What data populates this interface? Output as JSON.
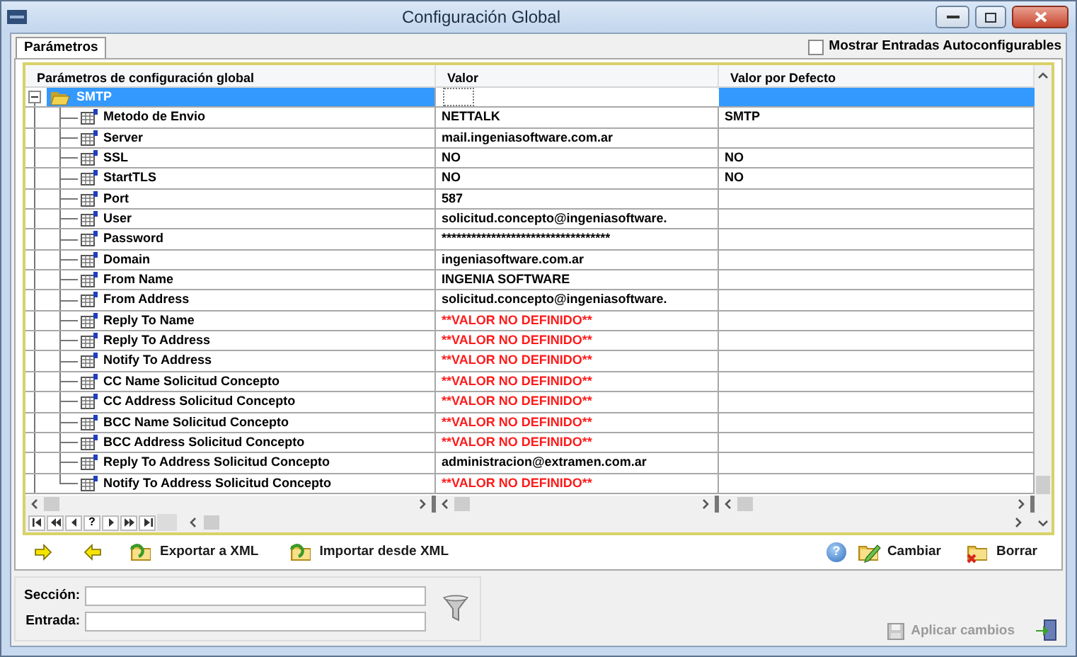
{
  "window": {
    "title": "Configuración Global"
  },
  "tabs": [
    {
      "label": "Parámetros",
      "selected": true
    }
  ],
  "show_auto_checkbox": {
    "label": "Mostrar Entradas Autoconfigurables",
    "checked": false
  },
  "grid": {
    "columns": [
      "Parámetros de configuración global",
      "Valor",
      "Valor por Defecto"
    ],
    "root": {
      "label": "SMTP",
      "expanded": true,
      "selected": true,
      "children": [
        {
          "name": "Metodo de Envio",
          "value": "NETTALK",
          "default": "SMTP",
          "missing": false
        },
        {
          "name": "Server",
          "value": "mail.ingeniasoftware.com.ar",
          "missing": false
        },
        {
          "name": "SSL",
          "value": "NO",
          "default": "NO",
          "missing": false
        },
        {
          "name": "StartTLS",
          "value": "NO",
          "default": "NO",
          "missing": false
        },
        {
          "name": "Port",
          "value": "587",
          "missing": false
        },
        {
          "name": "User",
          "value": "solicitud.concepto@ingeniasoftware.",
          "missing": false
        },
        {
          "name": "Password",
          "value": "**********************************",
          "missing": false
        },
        {
          "name": "Domain",
          "value": "ingeniasoftware.com.ar",
          "missing": false
        },
        {
          "name": "From Name",
          "value": "INGENIA SOFTWARE",
          "missing": false
        },
        {
          "name": "From Address",
          "value": "solicitud.concepto@ingeniasoftware.",
          "missing": false
        },
        {
          "name": "Reply To Name",
          "value": "**VALOR NO DEFINIDO**",
          "missing": true
        },
        {
          "name": "Reply To Address",
          "value": "**VALOR NO DEFINIDO**",
          "missing": true
        },
        {
          "name": "Notify To Address",
          "value": "**VALOR NO DEFINIDO**",
          "missing": true
        },
        {
          "name": "CC Name Solicitud Concepto",
          "value": "**VALOR NO DEFINIDO**",
          "missing": true
        },
        {
          "name": "CC Address Solicitud Concepto",
          "value": "**VALOR NO DEFINIDO**",
          "missing": true
        },
        {
          "name": "BCC Name Solicitud Concepto",
          "value": "**VALOR NO DEFINIDO**",
          "missing": true
        },
        {
          "name": "BCC Address Solicitud Concepto",
          "value": "**VALOR NO DEFINIDO**",
          "missing": true
        },
        {
          "name": "Reply To Address Solicitud Concepto",
          "value": "administracion@extramen.com.ar",
          "missing": false
        },
        {
          "name": "Notify To Address Solicitud Concepto",
          "value": "**VALOR NO DEFINIDO**",
          "missing": true
        }
      ]
    }
  },
  "navigator": [
    {
      "kind": "first"
    },
    {
      "kind": "prev_page"
    },
    {
      "kind": "prev"
    },
    {
      "kind": "find",
      "label": "?"
    },
    {
      "kind": "next"
    },
    {
      "kind": "next_page"
    },
    {
      "kind": "last"
    }
  ],
  "toolbar": {
    "left": [
      {
        "kind": "forward"
      },
      {
        "kind": "back"
      },
      {
        "kind": "export",
        "label": "Exportar a XML"
      },
      {
        "kind": "import",
        "label": "Importar desde XML"
      }
    ],
    "right": [
      {
        "kind": "help",
        "label": "?"
      },
      {
        "kind": "edit",
        "label": "Cambiar"
      },
      {
        "kind": "delete",
        "label": "Borrar"
      }
    ]
  },
  "filter": {
    "fields": [
      {
        "label": "Sección:"
      },
      {
        "label": "Entrada:"
      }
    ]
  },
  "apply_button": {
    "label": "Aplicar cambios",
    "disabled": true
  }
}
